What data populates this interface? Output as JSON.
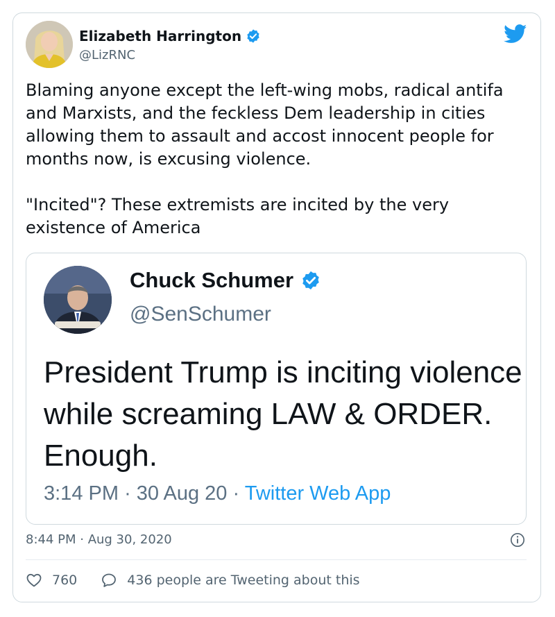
{
  "tweet": {
    "author_name": "Elizabeth Harrington",
    "author_handle": "@LizRNC",
    "text": "Blaming anyone except the left-wing mobs, radical antifa and Marxists, and the feckless Dem leadership in cities allowing them to assault and accost innocent people for months now, is excusing violence.\n\n\"Incited\"? These extremists are incited by the very existence of America",
    "timestamp": "8:44 PM · Aug 30, 2020",
    "like_count": "760",
    "reply_label": "436 people are Tweeting about this"
  },
  "quoted": {
    "author_name": "Chuck Schumer",
    "author_handle": "@SenSchumer",
    "text": "President Trump is inciting violence while screaming LAW & ORDER. Enough.",
    "time": "3:14 PM",
    "date": "30 Aug 20",
    "sep": "·",
    "source": "Twitter Web App"
  },
  "colors": {
    "accent": "#1d9bf0",
    "text": "#0f1419",
    "secondary": "#536471",
    "border": "#cfd9de"
  },
  "icons": {
    "verified": "verified-badge-icon",
    "brand": "twitter-bird-icon",
    "info": "info-icon",
    "like": "heart-icon",
    "reply": "speech-bubble-icon"
  }
}
